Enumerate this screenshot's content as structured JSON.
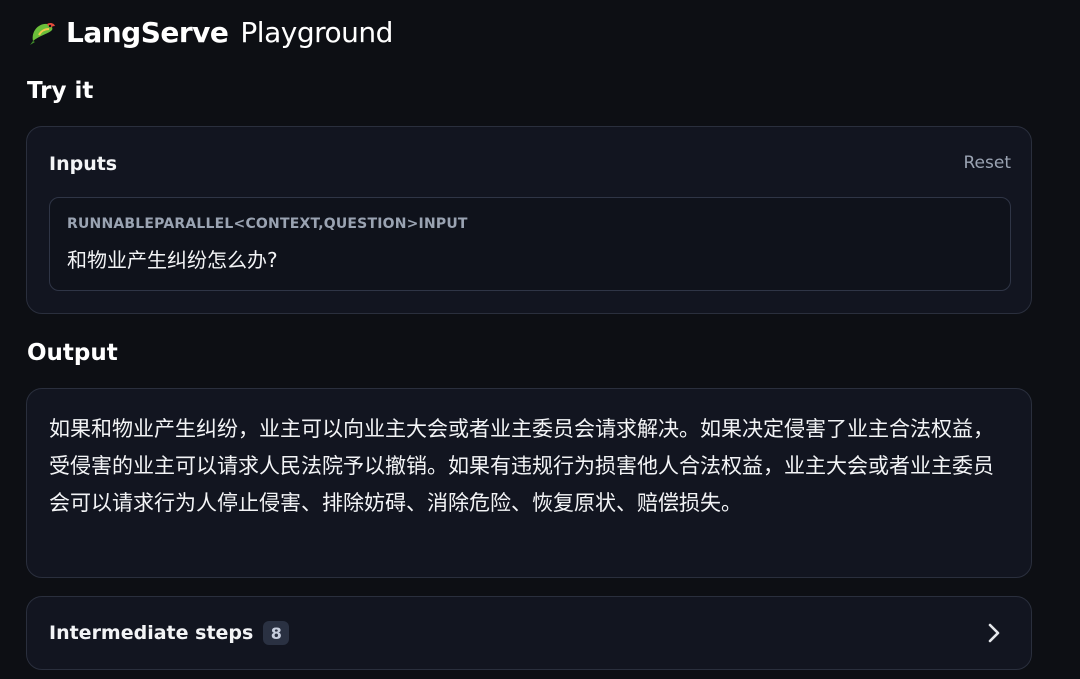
{
  "header": {
    "logo_icon": "parrot-icon",
    "title_main": "LangServe",
    "title_sub": "Playground"
  },
  "try_it": {
    "title": "Try it",
    "inputs_label": "Inputs",
    "reset_label": "Reset",
    "input_type_label": "RUNNABLEPARALLEL<CONTEXT,QUESTION>INPUT",
    "input_value": "和物业产生纠纷怎么办?"
  },
  "output": {
    "title": "Output",
    "text": "如果和物业产生纠纷，业主可以向业主大会或者业主委员会请求解决。如果决定侵害了业主合法权益，受侵害的业主可以请求人民法院予以撤销。如果有违规行为损害他人合法权益，业主大会或者业主委员会可以请求行为人停止侵害、排除妨碍、消除危险、恢复原状、赔偿损失。"
  },
  "intermediate_steps": {
    "label": "Intermediate steps",
    "count": "8",
    "chevron_icon": "chevron-right-icon"
  },
  "colors": {
    "background": "#0d0f14",
    "card": "#121520",
    "border": "#2a2f3d",
    "muted_text": "#9aa3b2"
  }
}
